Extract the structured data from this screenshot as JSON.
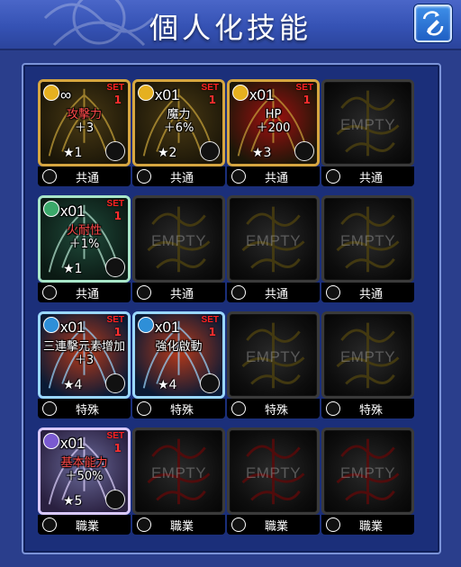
{
  "header": {
    "title": "個人化技能",
    "right_button_icon": "pencil-swap-icon"
  },
  "colors": {
    "header_bg": "#3552b4",
    "panel_bg": "#1b2f7a",
    "set_red": "#ff2222",
    "empty_label": "#c8c8c8"
  },
  "grid": {
    "rows": [
      {
        "slots": [
          {
            "state": "filled",
            "qty": "∞",
            "set": "SET",
            "count": "1",
            "name": "攻擊力",
            "name_color": "red",
            "value": "＋3",
            "stars": "★1",
            "frame": "gold",
            "badge_color": "#e5b020",
            "category": "共通"
          },
          {
            "state": "filled",
            "qty": "x01",
            "set": "SET",
            "count": "1",
            "name": "魔力",
            "name_color": "white",
            "value": "＋6%",
            "stars": "★2",
            "frame": "gold",
            "badge_color": "#e5b020",
            "category": "共通"
          },
          {
            "state": "filled",
            "qty": "x01",
            "set": "SET",
            "count": "1",
            "name": "HP",
            "name_color": "white",
            "value": "＋200",
            "stars": "★3",
            "frame": "gold",
            "badge_color": "#e5b020",
            "category": "共通"
          },
          {
            "state": "empty",
            "empty_label": "EMPTY",
            "ghost": "gold",
            "category": "共通"
          }
        ]
      },
      {
        "slots": [
          {
            "state": "filled",
            "qty": "x01",
            "set": "SET",
            "count": "1",
            "name": "火耐性",
            "name_color": "red",
            "value": "＋1%",
            "stars": "★1",
            "frame": "green",
            "badge_color": "#3ba86a",
            "category": "共通"
          },
          {
            "state": "empty",
            "empty_label": "EMPTY",
            "ghost": "gold",
            "category": "共通"
          },
          {
            "state": "empty",
            "empty_label": "EMPTY",
            "ghost": "gold",
            "category": "共通"
          },
          {
            "state": "empty",
            "empty_label": "EMPTY",
            "ghost": "gold",
            "category": "共通"
          }
        ]
      },
      {
        "slots": [
          {
            "state": "filled",
            "qty": "x01",
            "set": "SET",
            "count": "1",
            "name": "三連擊元素增加",
            "name_color": "white",
            "value": "＋3",
            "stars": "★4",
            "frame": "blue",
            "badge_color": "#2e8fd8",
            "category": "特殊"
          },
          {
            "state": "filled",
            "qty": "x01",
            "set": "SET",
            "count": "1",
            "name": "強化啟動",
            "name_color": "white",
            "value": "",
            "stars": "★4",
            "frame": "blue",
            "badge_color": "#2e8fd8",
            "category": "特殊"
          },
          {
            "state": "empty",
            "empty_label": "EMPTY",
            "ghost": "gold",
            "category": "特殊"
          },
          {
            "state": "empty",
            "empty_label": "EMPTY",
            "ghost": "gold",
            "category": "特殊"
          }
        ]
      },
      {
        "slots": [
          {
            "state": "filled",
            "qty": "x01",
            "set": "SET",
            "count": "1",
            "name": "基本能力",
            "name_color": "red",
            "value": "＋50%",
            "stars": "★5",
            "frame": "purple",
            "badge_color": "#7a5ad0",
            "category": "職業"
          },
          {
            "state": "empty",
            "empty_label": "EMPTY",
            "ghost": "red",
            "category": "職業"
          },
          {
            "state": "empty",
            "empty_label": "EMPTY",
            "ghost": "red",
            "category": "職業"
          },
          {
            "state": "empty",
            "empty_label": "EMPTY",
            "ghost": "red",
            "category": "職業"
          }
        ]
      }
    ]
  }
}
